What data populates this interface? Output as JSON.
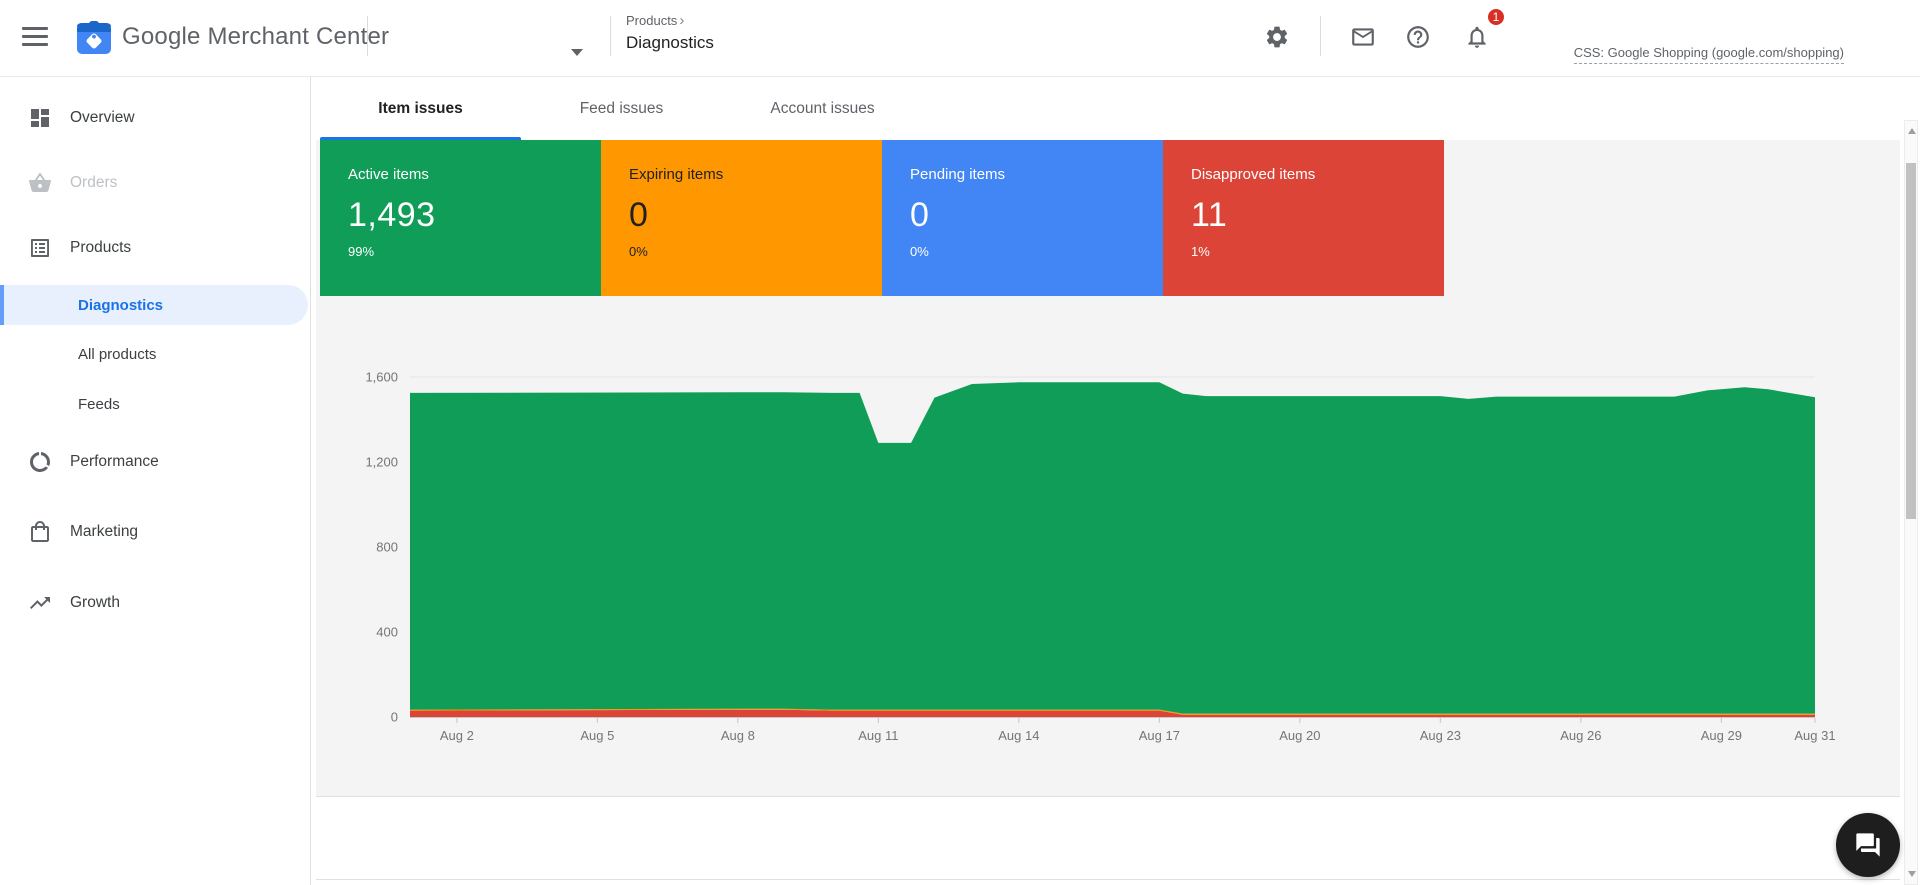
{
  "topbar": {
    "brand": "Google Merchant Center",
    "account_selector": {
      "value": ""
    },
    "breadcrumb": {
      "parent": "Products",
      "current": "Diagnostics"
    },
    "css_label": "CSS: Google Shopping (google.com/shopping)",
    "notification_count": "1"
  },
  "sidebar": {
    "items": [
      {
        "label": "Overview",
        "icon": "dashboard-grid",
        "state": "normal"
      },
      {
        "label": "Orders",
        "icon": "shopping-basket",
        "state": "disabled"
      },
      {
        "label": "Products",
        "icon": "list-card",
        "state": "expanded"
      },
      {
        "label": "Diagnostics",
        "state": "selected",
        "child": true
      },
      {
        "label": "All products",
        "state": "normal",
        "child": true
      },
      {
        "label": "Feeds",
        "state": "normal",
        "child": true
      },
      {
        "label": "Performance",
        "icon": "donut-arc",
        "state": "normal"
      },
      {
        "label": "Marketing",
        "icon": "shopping-bag",
        "state": "normal"
      },
      {
        "label": "Growth",
        "icon": "trending-up",
        "state": "normal"
      }
    ]
  },
  "tabs": [
    {
      "label": "Item issues",
      "active": true
    },
    {
      "label": "Feed issues",
      "active": false
    },
    {
      "label": "Account issues",
      "active": false
    }
  ],
  "cards": [
    {
      "label": "Active items",
      "value": "1,493",
      "percent": "99%",
      "color": "#0f9d58",
      "text_style": "light"
    },
    {
      "label": "Expiring items",
      "value": "0",
      "percent": "0%",
      "color": "#ff9800",
      "text_style": "dark"
    },
    {
      "label": "Pending items",
      "value": "0",
      "percent": "0%",
      "color": "#4285f4",
      "text_style": "light"
    },
    {
      "label": "Disapproved items",
      "value": "11",
      "percent": "1%",
      "color": "#db4437",
      "text_style": "light"
    }
  ],
  "chart_data": {
    "type": "area",
    "stacked": true,
    "title": "",
    "xlabel": "",
    "ylabel": "",
    "x_unit": "day of August",
    "x": [
      1,
      8,
      9,
      10,
      10.6,
      11,
      11.7,
      12.2,
      13,
      14,
      17,
      17.5,
      18,
      23,
      23.6,
      24.2,
      28,
      28.7,
      29.5,
      30,
      31
    ],
    "series": [
      {
        "name": "Disapproved items",
        "color": "#db4437",
        "values": [
          30,
          34,
          34,
          30,
          30,
          30,
          30,
          30,
          30,
          30,
          30,
          11,
          11,
          11,
          11,
          11,
          11,
          11,
          11,
          11,
          11
        ]
      },
      {
        "name": "Expiring items",
        "color": "#ff9800",
        "values": [
          5,
          5,
          5,
          5,
          5,
          5,
          5,
          5,
          5,
          5,
          5,
          5,
          5,
          5,
          5,
          5,
          5,
          5,
          5,
          5,
          5
        ]
      },
      {
        "name": "Pending items",
        "color": "#4285f4",
        "values": [
          0,
          0,
          0,
          0,
          0,
          0,
          0,
          0,
          0,
          0,
          0,
          0,
          0,
          0,
          0,
          0,
          0,
          0,
          0,
          0,
          0
        ]
      },
      {
        "name": "Active items",
        "color": "#0f9d58",
        "values": [
          1490,
          1489,
          1489,
          1490,
          1490,
          1255,
          1255,
          1468,
          1532,
          1540,
          1540,
          1506,
          1494,
          1494,
          1481,
          1492,
          1492,
          1521,
          1536,
          1526,
          1489
        ]
      }
    ],
    "ylim": [
      0,
      1600
    ],
    "yticks": [
      {
        "value": 0,
        "label": "0"
      },
      {
        "value": 400,
        "label": "400"
      },
      {
        "value": 800,
        "label": "800"
      },
      {
        "value": 1200,
        "label": "1,200"
      },
      {
        "value": 1600,
        "label": "1,600"
      }
    ],
    "xticks": [
      {
        "value": 2,
        "label": "Aug 2"
      },
      {
        "value": 5,
        "label": "Aug 5"
      },
      {
        "value": 8,
        "label": "Aug 8"
      },
      {
        "value": 11,
        "label": "Aug 11"
      },
      {
        "value": 14,
        "label": "Aug 14"
      },
      {
        "value": 17,
        "label": "Aug 17"
      },
      {
        "value": 20,
        "label": "Aug 20"
      },
      {
        "value": 23,
        "label": "Aug 23"
      },
      {
        "value": 26,
        "label": "Aug 26"
      },
      {
        "value": 29,
        "label": "Aug 29"
      },
      {
        "value": 31,
        "label": "Aug 31"
      }
    ],
    "grid": true,
    "legend": "none"
  },
  "icons": {
    "menu": "hamburger-lines",
    "dropdown": "caret-down",
    "settings": "gear",
    "messages": "envelope",
    "help": "question-circle",
    "notifications": "bell",
    "overview": "dashboard-grid",
    "orders": "shopping-basket",
    "products": "list-card",
    "performance": "donut-arc",
    "marketing": "shopping-bag",
    "growth": "trending-up",
    "chat_fab": "forum-bubbles"
  },
  "colors": {
    "accent_blue": "#1a73e8",
    "active_green": "#0f9d58",
    "expiring_orange": "#ff9800",
    "pending_blue": "#4285f4",
    "disapproved_red": "#db4437",
    "badge_red": "#d93025",
    "selected_pill": "#e8f0fe"
  }
}
